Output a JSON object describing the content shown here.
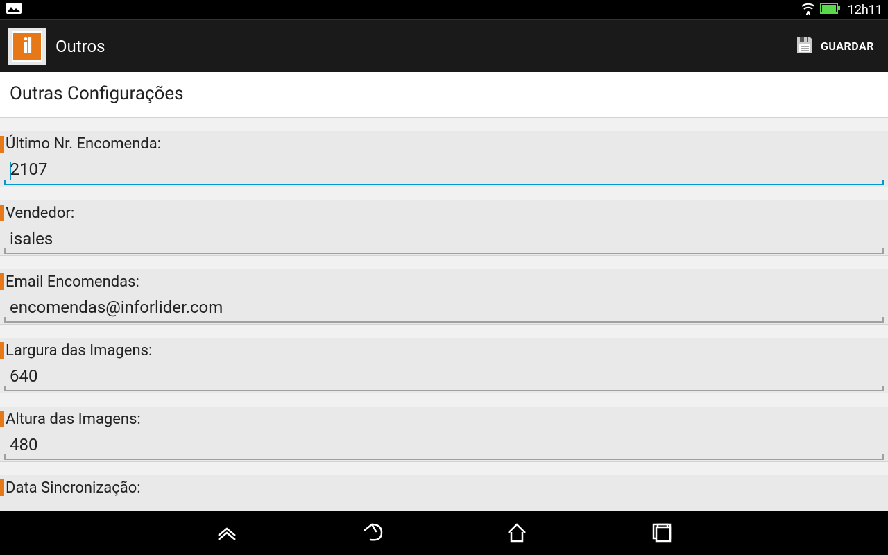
{
  "status": {
    "time": "12h11"
  },
  "actionbar": {
    "title": "Outros",
    "save_label": "GUARDAR",
    "logo_text": "il"
  },
  "section": {
    "header": "Outras Configurações"
  },
  "fields": {
    "last_order": {
      "label": "Último Nr. Encomenda:",
      "value": "2107"
    },
    "seller": {
      "label": "Vendedor:",
      "value": "isales"
    },
    "email": {
      "label": "Email Encomendas:",
      "value": "encomendas@inforlider.com"
    },
    "img_width": {
      "label": "Largura das Imagens:",
      "value": "640"
    },
    "img_height": {
      "label": "Altura das Imagens:",
      "value": "480"
    },
    "sync_date": {
      "label": "Data Sincronização:",
      "value": ""
    }
  },
  "colors": {
    "accent": "#e67817",
    "focus": "#0099cc"
  }
}
